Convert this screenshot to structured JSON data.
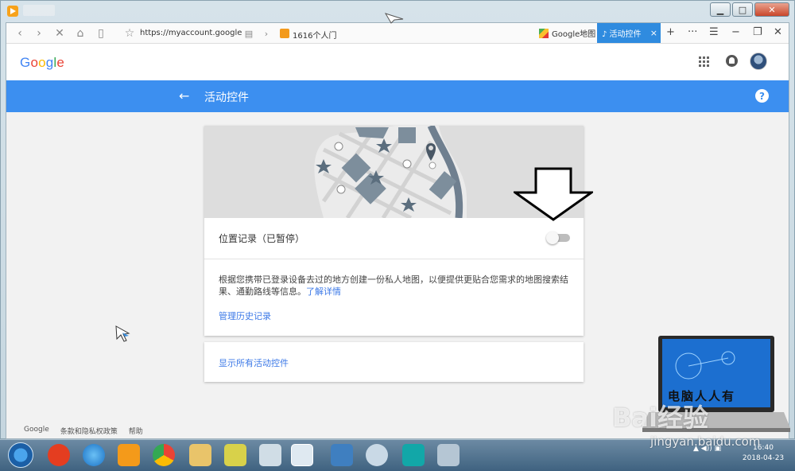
{
  "browser": {
    "url": "https://myaccount.google",
    "tab_mid_label": "1616个人门",
    "tab_maps_label": "Google地图",
    "tab_active_label": "♪ 活动控件",
    "close_tab": "×"
  },
  "window_controls": {
    "minimize": "▁",
    "maximize": "□",
    "close": "✕"
  },
  "toolbar_right": {
    "new_tab": "+",
    "more": "···",
    "menu": "☰",
    "minimize": "−",
    "restore": "❐",
    "close": "✕"
  },
  "google": {
    "logo_letters": [
      "G",
      "o",
      "o",
      "g",
      "l",
      "e"
    ]
  },
  "header": {
    "back": "←",
    "title": "活动控件",
    "help": "?"
  },
  "setting": {
    "label": "位置记录（已暂停）",
    "enabled": false,
    "description": "根据您携带已登录设备去过的地方创建一份私人地图，以便提供更贴合您需求的地图搜索结果、通勤路线等信息。",
    "learn_more": "了解详情",
    "manage_history": "管理历史记录"
  },
  "show_all": "显示所有活动控件",
  "footer": {
    "items": [
      "Google",
      "条款和隐私权政策",
      "帮助"
    ]
  },
  "taskbar": {
    "tray": "▲ ◀)) ▣",
    "time": "16:40",
    "date": "2018-04-23"
  },
  "watermark": {
    "logo": "Bai经验",
    "url": "jingyan.baidu.com",
    "laptop_text": "电脑人人有"
  },
  "colors": {
    "blue_bar": "#3c8ff0",
    "active_tab": "#2f8bdf",
    "link": "#3b78e7"
  }
}
